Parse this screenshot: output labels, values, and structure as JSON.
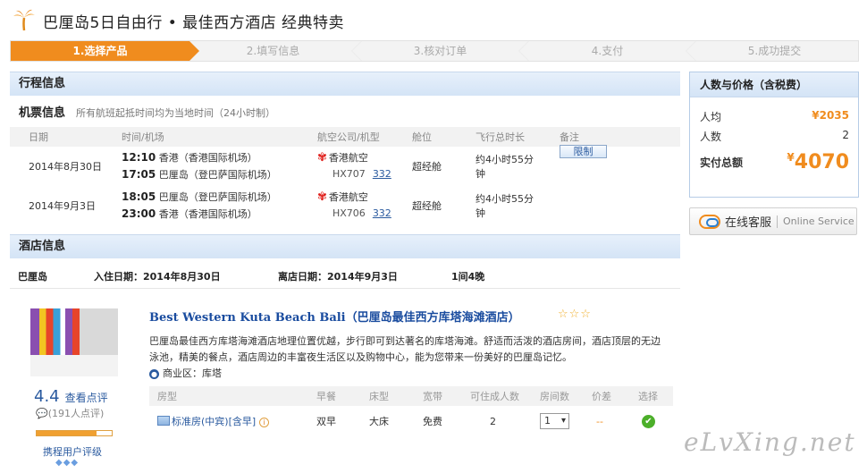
{
  "header": {
    "title": "巴厘岛5日自由行 • 最佳西方酒店  经典特卖"
  },
  "steps": [
    "1.选择产品",
    "2.填写信息",
    "3.核对订单",
    "4.支付",
    "5.成功提交"
  ],
  "itinerary": {
    "title": "行程信息",
    "flight_heading": "机票信息",
    "flight_note": "所有航班起抵时间均为当地时间（24小时制）",
    "columns": [
      "日期",
      "时间/机场",
      "航空公司/机型",
      "舱位",
      "飞行总时长",
      "备注"
    ],
    "flights": [
      {
        "date": "2014年8月30日",
        "dep_time": "12:10",
        "dep_place": "香港（香港国际机场）",
        "arr_time": "17:05",
        "arr_place": "巴厘岛（登巴萨国际机场）",
        "airline": "香港航空",
        "flight_no": "HX707",
        "plane": "332",
        "cabin": "超经舱",
        "duration": "约4小时55分钟",
        "remark": "限制"
      },
      {
        "date": "2014年9月3日",
        "dep_time": "18:05",
        "dep_place": "巴厘岛（登巴萨国际机场）",
        "arr_time": "23:00",
        "arr_place": "香港（香港国际机场）",
        "airline": "香港航空",
        "flight_no": "HX706",
        "plane": "332",
        "cabin": "超经舱",
        "duration": "约4小时55分钟",
        "remark": ""
      }
    ]
  },
  "hotel_section": {
    "title": "酒店信息",
    "city": "巴厘岛",
    "checkin": "入住日期：2014年8月30日",
    "checkout": "离店日期：2014年9月3日",
    "nights": "1间4晚"
  },
  "hotel": {
    "name": "Best Western Kuta Beach Bali（巴厘岛最佳西方库塔海滩酒店）",
    "stars": "☆☆☆",
    "description": "巴厘岛最佳西方库塔海滩酒店地理位置优越，步行即可到达著名的库塔海滩。舒适而活泼的酒店房间，酒店顶层的无边泳池，精美的餐点，酒店周边的丰富夜生活区以及购物中心，能为您带来一份美好的巴厘岛记忆。",
    "area": "商业区：库塔",
    "score": "4.4",
    "score_link": "查看点评",
    "reviews": "(191人点评)",
    "rating_label": "携程用户评级",
    "diamonds": "◆◆◆"
  },
  "rooms": {
    "columns": [
      "房型",
      "早餐",
      "床型",
      "宽带",
      "可住成人数",
      "房间数",
      "价差",
      "选择"
    ],
    "rows": [
      {
        "name": "标准房(中宾)[含早]",
        "breakfast": "双早",
        "bed": "大床",
        "broadband": "免费",
        "adults": "2",
        "qty": "1",
        "diff": "--"
      }
    ]
  },
  "price_box": {
    "title": "人数与价格（含税费）",
    "per_person_label": "人均",
    "per_person": "¥2035",
    "count_label": "人数",
    "count": "2",
    "total_label": "实付总额",
    "currency": "¥",
    "total": "4070"
  },
  "service": {
    "cn": "在线客服",
    "en": "Online Service"
  },
  "watermark": "eLvXing.net",
  "colors": {
    "accent": "#f08c1e",
    "link": "#2a5a9f"
  }
}
